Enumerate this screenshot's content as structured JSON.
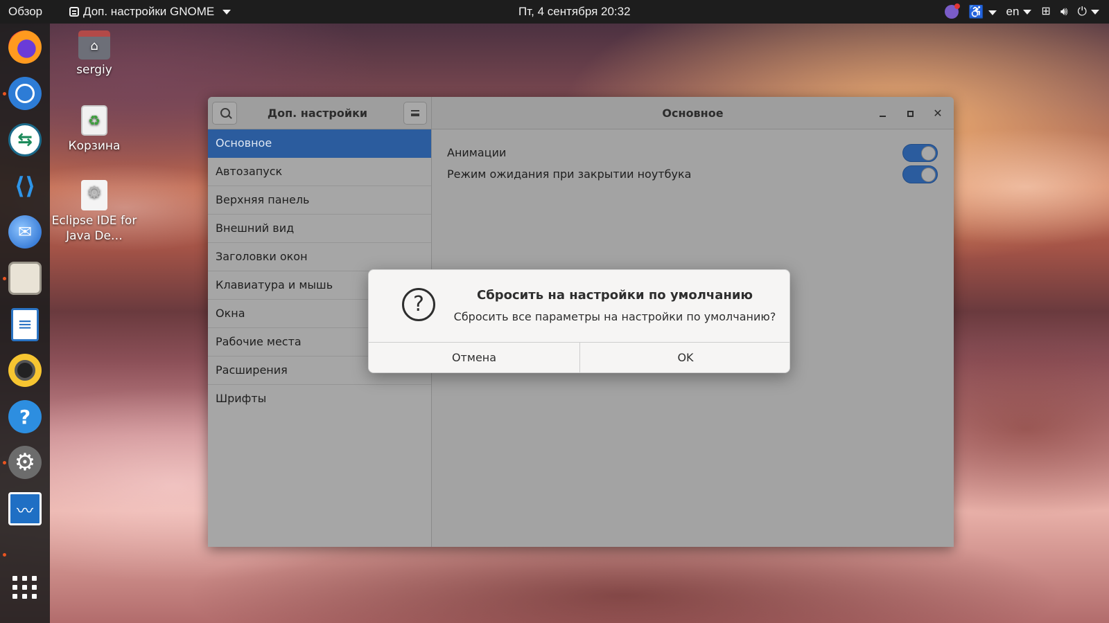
{
  "topbar": {
    "activities": "Обзор",
    "app_menu": "Доп. настройки GNOME",
    "clock": "Пт, 4 сентября  20:32",
    "language": "en",
    "indicators": [
      "viber-icon",
      "accessibility-icon",
      "network-icon",
      "volume-icon",
      "power-icon"
    ]
  },
  "dock": {
    "apps": [
      "Firefox",
      "Chromium",
      "Remmina",
      "Visual Studio Code",
      "Thunderbird",
      "Files",
      "LibreOffice Writer",
      "Rhythmbox",
      "Help",
      "Settings",
      "System Monitor",
      "Show Applications"
    ],
    "accent_color": "#e95420"
  },
  "desktop": {
    "icons": [
      {
        "label": "sergiy"
      },
      {
        "label": "Корзина"
      },
      {
        "label": "Eclipse IDE for Java De…"
      }
    ]
  },
  "window": {
    "app_title": "Доп. настройки GNOME",
    "page_title": "Основное",
    "sidebar": [
      {
        "label": "Основное",
        "active": true
      },
      {
        "label": "Автозапуск"
      },
      {
        "label": "Верхняя панель"
      },
      {
        "label": "Внешний вид"
      },
      {
        "label": "Заголовки окон"
      },
      {
        "label": "Клавиатура и мышь"
      },
      {
        "label": "Окна"
      },
      {
        "label": "Рабочие места"
      },
      {
        "label": "Расширения"
      },
      {
        "label": "Шрифты"
      }
    ],
    "settings": [
      {
        "label": "Анимации",
        "enabled": true
      },
      {
        "label": "Режим ожидания при закрытии ноутбука",
        "enabled": true
      }
    ],
    "accent_color": "#2b5c9e"
  },
  "dialog": {
    "title": "Сбросить на настройки по умолчанию",
    "message": "Сбросить все параметры на настройки по умолчанию?",
    "cancel_label": "Отмена",
    "ok_label": "OK"
  }
}
